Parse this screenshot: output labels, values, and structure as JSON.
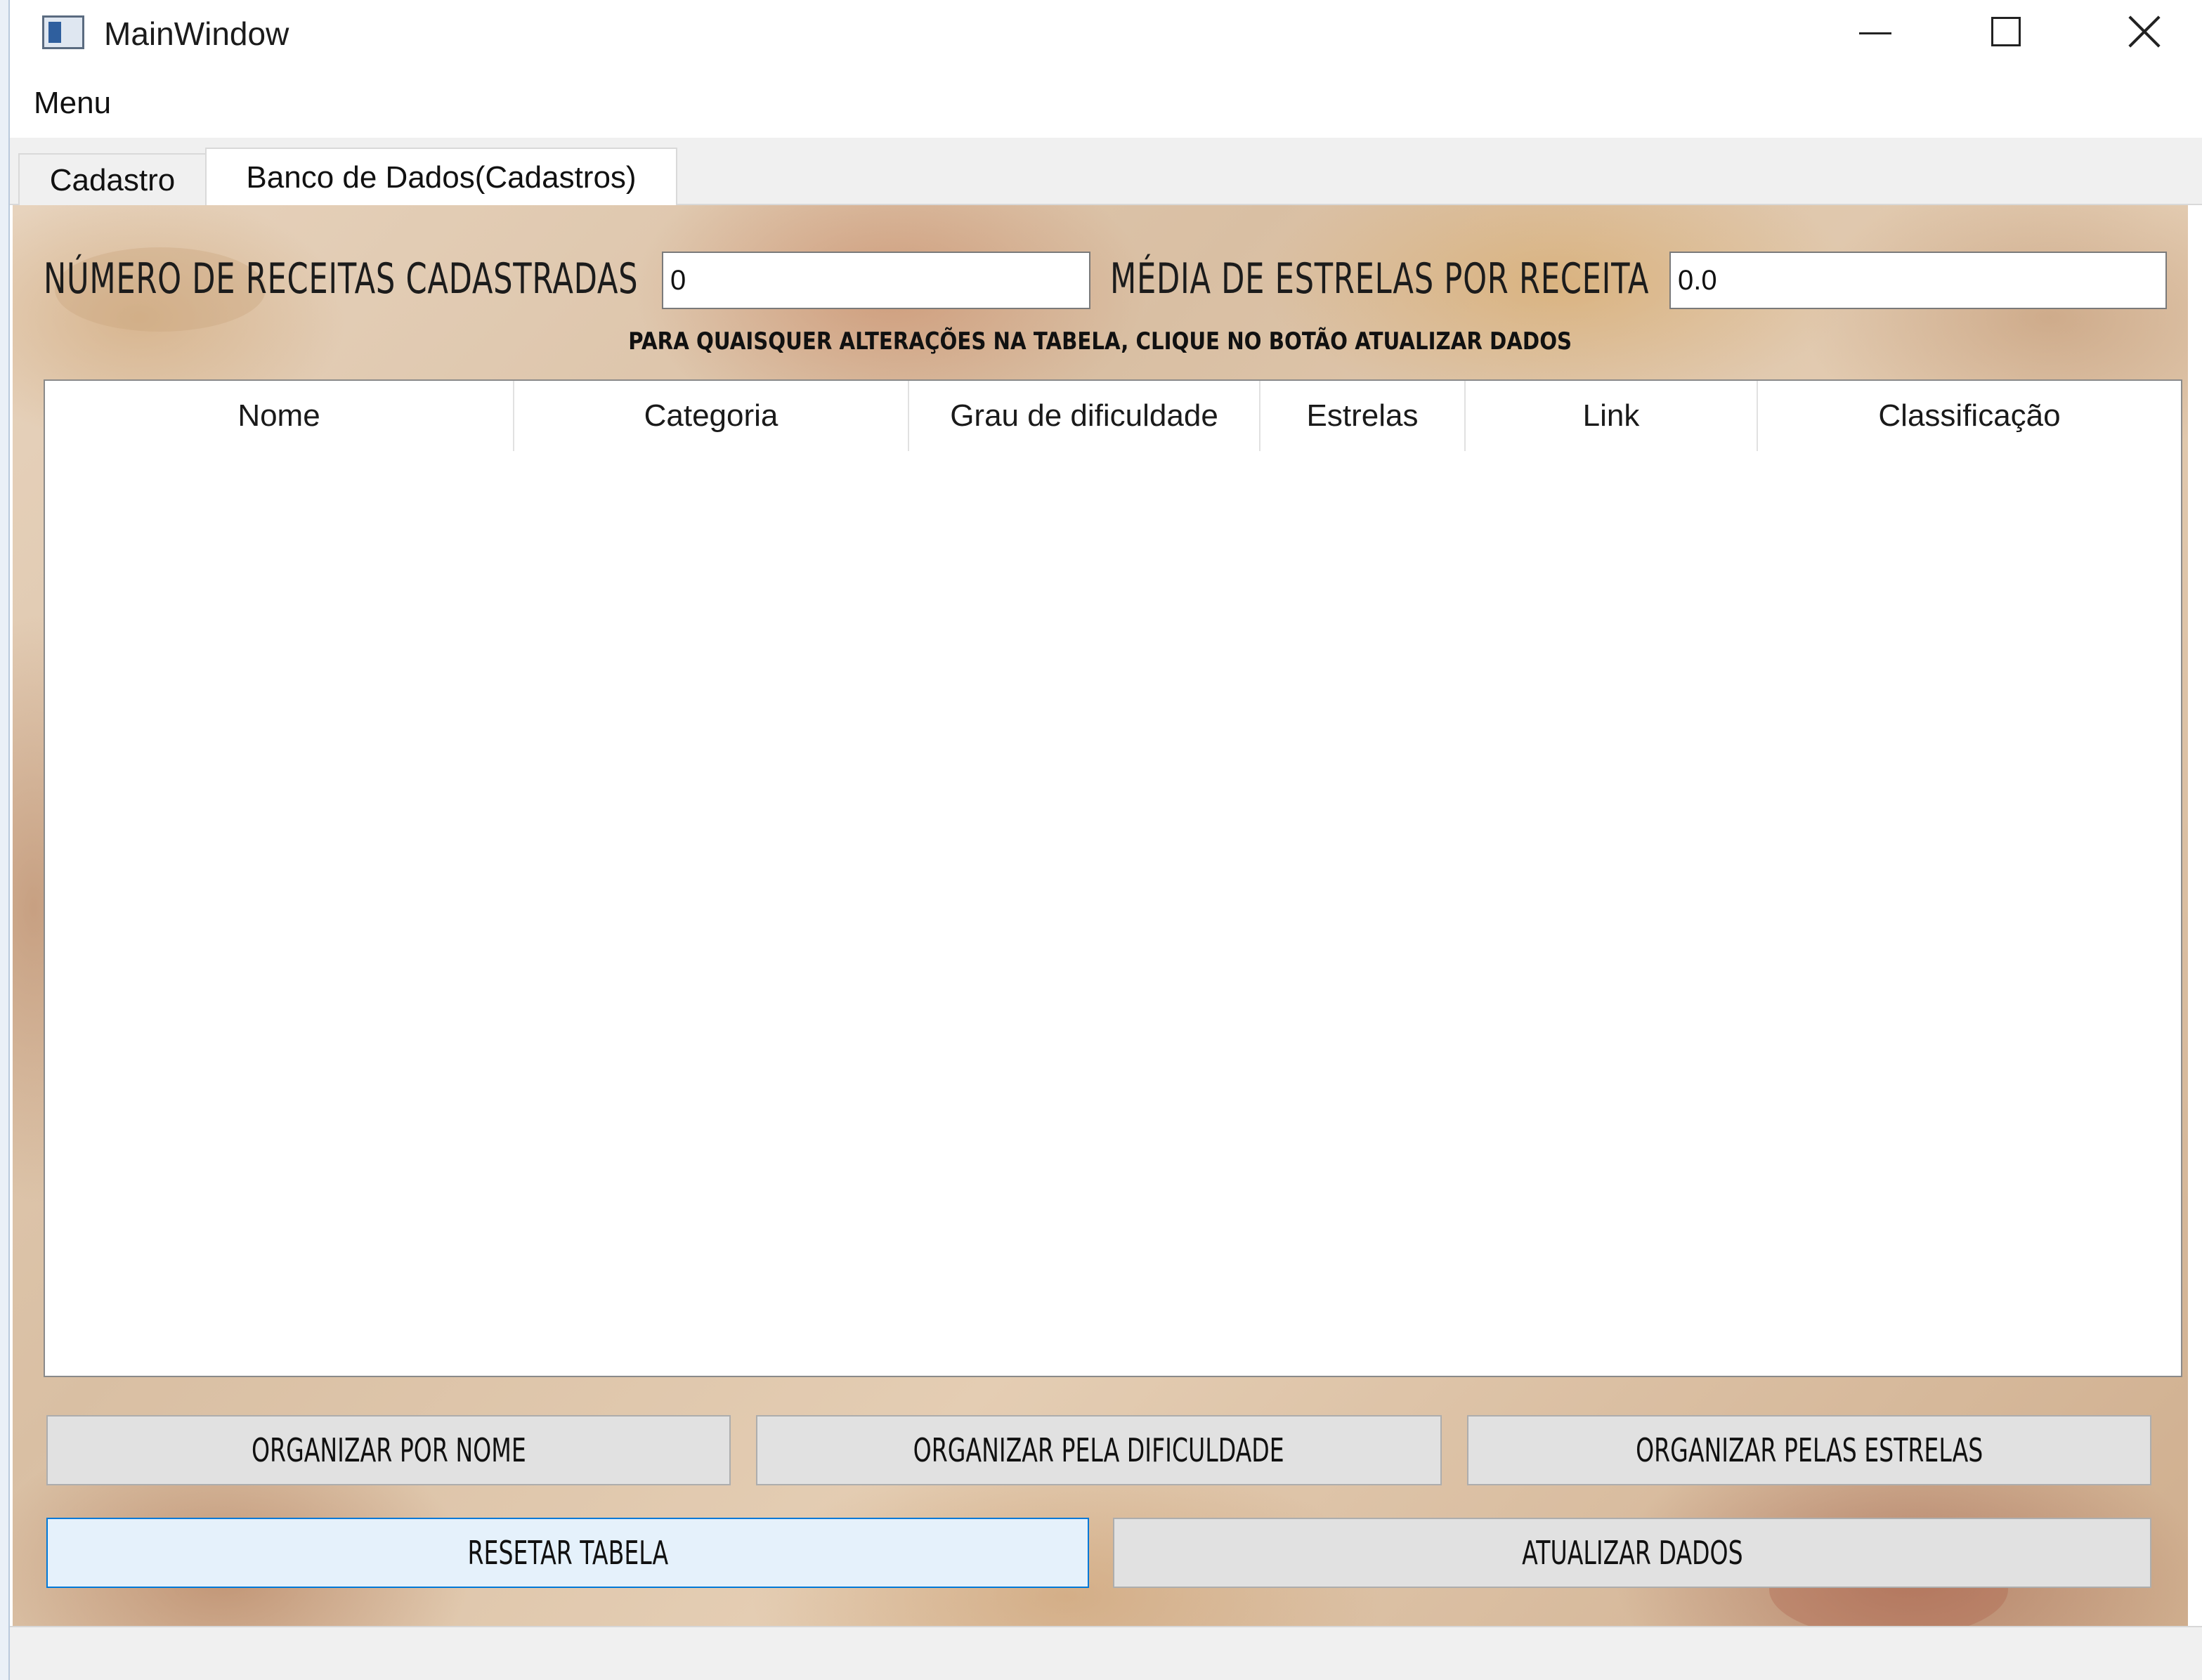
{
  "window": {
    "title": "MainWindow"
  },
  "menubar": {
    "items": [
      "Menu"
    ]
  },
  "tabs": [
    {
      "label": "Cadastro",
      "active": false
    },
    {
      "label": "Banco de Dados(Cadastros)",
      "active": true
    }
  ],
  "stats": {
    "num_label": "NÚMERO DE RECEITAS CADASTRADAS",
    "num_value": "0",
    "media_label": "MÉDIA DE ESTRELAS POR RECEITA",
    "media_value": "0.0"
  },
  "hint": "PARA QUAISQUER ALTERAÇÕES NA TABELA, CLIQUE NO BOTÃO ATUALIZAR DADOS",
  "table": {
    "columns": [
      "Nome",
      "Categoria",
      "Grau de dificuldade",
      "Estrelas",
      "Link",
      "Classificação"
    ],
    "rows": []
  },
  "buttons": {
    "sort_name": "ORGANIZAR POR NOME",
    "sort_difficulty": "ORGANIZAR PELA DIFICULDADE",
    "sort_stars": "ORGANIZAR PELAS ESTRELAS",
    "reset": "RESETAR TABELA",
    "update": "ATUALIZAR DADOS"
  },
  "icons": {
    "app": "app-window-icon",
    "minimize": "minimize-icon",
    "maximize": "maximize-icon",
    "close": "close-icon"
  },
  "colors": {
    "focus_accent": "#0078d7",
    "button_bg": "#e1e1e1",
    "focused_button_bg": "#e5f1fb"
  }
}
